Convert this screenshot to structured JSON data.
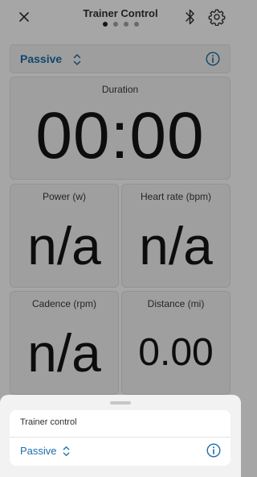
{
  "header": {
    "title": "Trainer Control",
    "pages": {
      "count": 4,
      "active": 0
    }
  },
  "mode": {
    "selected": "Passive"
  },
  "metrics": {
    "duration": {
      "label": "Duration",
      "value": "00:00"
    },
    "power": {
      "label": "Power (w)",
      "value": "n/a"
    },
    "heart_rate": {
      "label": "Heart rate (bpm)",
      "value": "n/a"
    },
    "cadence": {
      "label": "Cadence (rpm)",
      "value": "n/a"
    },
    "distance": {
      "label": "Distance (mi)",
      "value": "0.00"
    }
  },
  "sheet": {
    "title": "Trainer control",
    "mode": "Passive"
  },
  "icons": {
    "close": "close-icon",
    "bluetooth": "bluetooth-icon",
    "settings": "gear-icon",
    "selector": "chevron-up-down-icon",
    "info": "info-icon"
  },
  "colors": {
    "accent_dimmed": "#11476a",
    "accent": "#1c6ea9",
    "overlay_bg": "#a6a6a6",
    "sheet_bg": "#f2f2f2"
  }
}
